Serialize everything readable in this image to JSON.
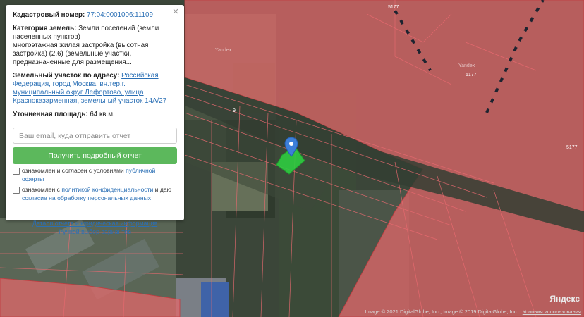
{
  "panel": {
    "cadastral_label": "Кадастровый номер:",
    "cadastral_number": "77:04:0001006:11109",
    "category_label": "Категория земель:",
    "category_value": "Земли поселений (земли населенных пунктов)",
    "category_detail": "многоэтажная жилая застройка (высотная застройка) (2.6) (земельные участки, предназначенные для размещения...",
    "address_label": "Земельный участок по адресу:",
    "address_value": "Российская Федерация, город Москва, вн.тер.г. муниципальный округ Лефортово, улица Красноказарменная, земельный участок 14А/27",
    "area_label": "Уточненная площадь:",
    "area_value": "64 кв.м.",
    "email_placeholder": "Ваш email, куда отправить отчет",
    "submit_label": "Получить подробный отчет",
    "consent1_text": "ознакомлен и согласен с условиями",
    "consent1_link": "публичной оферты",
    "consent2_text": "ознакомлен с",
    "consent2_link": "политикой конфиденциальности",
    "consent2_mid": "и даю",
    "consent2_link2": "согласие на обработку персональных данных",
    "details_link": "Детали отчета и юридическая информация",
    "manual_link": "Ручной выбор вариантов",
    "close_glyph": "×"
  },
  "map": {
    "labels": [
      "5177",
      "5177",
      "5177",
      "Yandex",
      "Yandex",
      "9",
      "Яндекс"
    ],
    "attribution": "Image © 2021 DigitalGlobe, Inc., Image © 2019 DigitalGlobe, Inc.",
    "terms_link": "Условия использования",
    "marker_icon": "map-pin-icon",
    "colors": {
      "zone_fill": "#e8686b",
      "parcel_fill": "#2ecc40",
      "marker": "#3d7fd9"
    }
  }
}
